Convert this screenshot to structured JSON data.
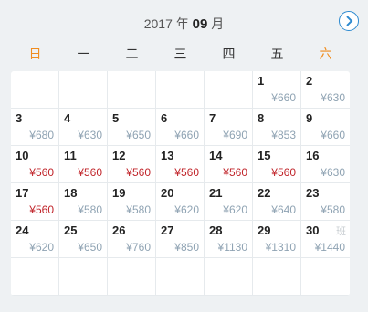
{
  "header": {
    "year_prefix": "2017 年 ",
    "month": "09",
    "month_suffix": " 月"
  },
  "weekdays": [
    "日",
    "一",
    "二",
    "三",
    "四",
    "五",
    "六"
  ],
  "colors": {
    "weekend": "#f08c1e",
    "low_price": "#c0242a",
    "normal_price": "#8fa3b3",
    "nav": "#2d8ad0"
  },
  "icons": {
    "next": "chevron-right-circle-icon"
  },
  "days": [
    null,
    null,
    null,
    null,
    null,
    {
      "day": "1",
      "price": "¥660",
      "low": false
    },
    {
      "day": "2",
      "price": "¥630",
      "low": false
    },
    {
      "day": "3",
      "price": "¥680",
      "low": false
    },
    {
      "day": "4",
      "price": "¥630",
      "low": false
    },
    {
      "day": "5",
      "price": "¥650",
      "low": false
    },
    {
      "day": "6",
      "price": "¥660",
      "low": false
    },
    {
      "day": "7",
      "price": "¥690",
      "low": false
    },
    {
      "day": "8",
      "price": "¥853",
      "low": false
    },
    {
      "day": "9",
      "price": "¥660",
      "low": false
    },
    {
      "day": "10",
      "price": "¥560",
      "low": true
    },
    {
      "day": "11",
      "price": "¥560",
      "low": true
    },
    {
      "day": "12",
      "price": "¥560",
      "low": true
    },
    {
      "day": "13",
      "price": "¥560",
      "low": true
    },
    {
      "day": "14",
      "price": "¥560",
      "low": true
    },
    {
      "day": "15",
      "price": "¥560",
      "low": true
    },
    {
      "day": "16",
      "price": "¥630",
      "low": false
    },
    {
      "day": "17",
      "price": "¥560",
      "low": true
    },
    {
      "day": "18",
      "price": "¥580",
      "low": false
    },
    {
      "day": "19",
      "price": "¥580",
      "low": false
    },
    {
      "day": "20",
      "price": "¥620",
      "low": false
    },
    {
      "day": "21",
      "price": "¥620",
      "low": false
    },
    {
      "day": "22",
      "price": "¥640",
      "low": false
    },
    {
      "day": "23",
      "price": "¥580",
      "low": false
    },
    {
      "day": "24",
      "price": "¥620",
      "low": false
    },
    {
      "day": "25",
      "price": "¥650",
      "low": false
    },
    {
      "day": "26",
      "price": "¥760",
      "low": false
    },
    {
      "day": "27",
      "price": "¥850",
      "low": false
    },
    {
      "day": "28",
      "price": "¥1130",
      "low": false
    },
    {
      "day": "29",
      "price": "¥1310",
      "low": false
    },
    {
      "day": "30",
      "price": "¥1440",
      "low": false,
      "tag": "班"
    },
    null,
    null,
    null,
    null,
    null,
    null,
    null
  ]
}
